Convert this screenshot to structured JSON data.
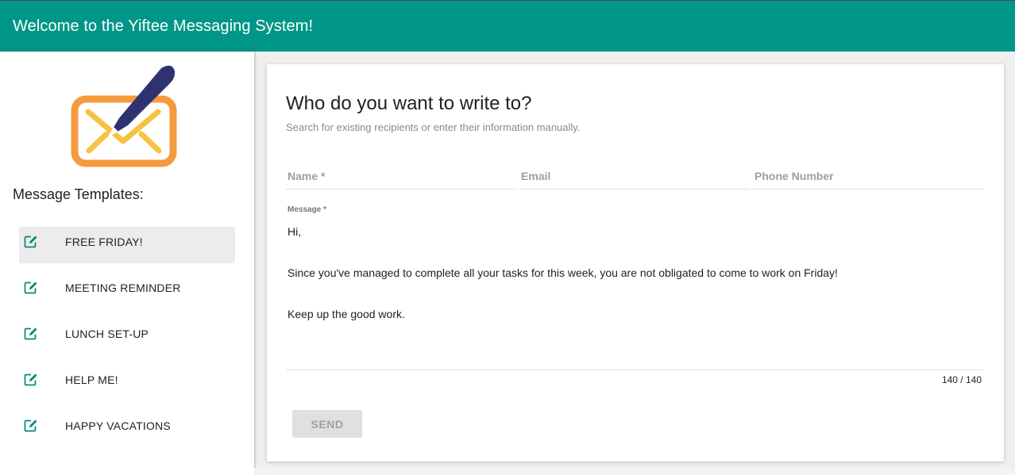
{
  "header": {
    "title": "Welcome to the Yiftee Messaging System!",
    "color": "#009688"
  },
  "sidebar": {
    "logo_icon": "envelope-pen-icon",
    "heading": "Message Templates:",
    "items": [
      {
        "label": "FREE FRIDAY!",
        "icon": "edit-icon",
        "active": true
      },
      {
        "label": "MEETING REMINDER",
        "icon": "edit-icon",
        "active": false
      },
      {
        "label": "LUNCH SET-UP",
        "icon": "edit-icon",
        "active": false
      },
      {
        "label": "HELP ME!",
        "icon": "edit-icon",
        "active": false
      },
      {
        "label": "HAPPY VACATIONS",
        "icon": "edit-icon",
        "active": false
      }
    ]
  },
  "form": {
    "title": "Who do you want to write to?",
    "subtitle": "Search for existing recipients or enter their information manually.",
    "name_placeholder": "Name *",
    "email_placeholder": "Email",
    "phone_placeholder": "Phone Number",
    "message_label": "Message *",
    "message_lines": [
      "Hi,",
      "Since you've managed to complete all your tasks for this week, you are not obligated to come to work on Friday!",
      "Keep up the good work."
    ],
    "counter": "140 / 140",
    "send_label": "SEND"
  },
  "colors": {
    "accent": "#009688",
    "logo_orange": "#f59a3e",
    "logo_yellow": "#f7c242",
    "pen_navy": "#2e3370"
  }
}
